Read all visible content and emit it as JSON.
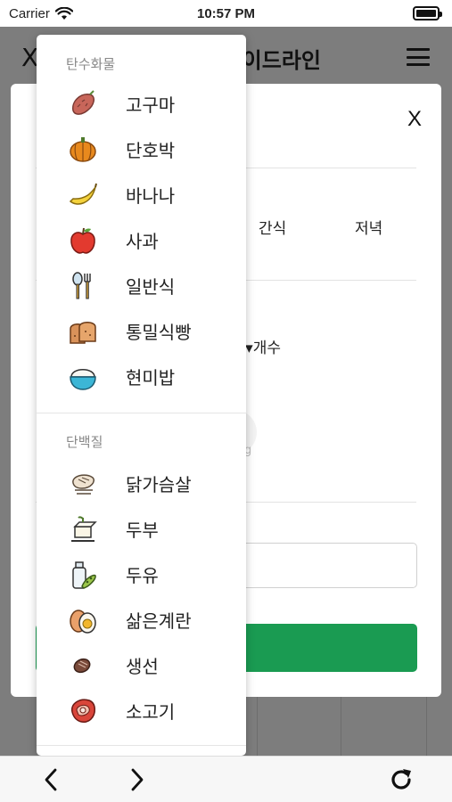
{
  "status_bar": {
    "carrier": "Carrier",
    "time": "10:57 PM"
  },
  "header": {
    "close_label": "X",
    "title": "식단 가이드라인"
  },
  "modal": {
    "close_label": "X",
    "meal_tabs": [
      "간식",
      "저녁"
    ],
    "unit_select_label": "개수▾",
    "ghost_text": "g"
  },
  "dropdown": {
    "groups": [
      {
        "title": "탄수화물",
        "items": [
          {
            "label": "고구마",
            "icon": "sweet-potato-icon"
          },
          {
            "label": "단호박",
            "icon": "pumpkin-icon"
          },
          {
            "label": "바나나",
            "icon": "banana-icon"
          },
          {
            "label": "사과",
            "icon": "apple-icon"
          },
          {
            "label": "일반식",
            "icon": "utensils-icon"
          },
          {
            "label": "통밀식빵",
            "icon": "bread-icon"
          },
          {
            "label": "현미밥",
            "icon": "rice-bowl-icon"
          }
        ]
      },
      {
        "title": "단백질",
        "items": [
          {
            "label": "닭가슴살",
            "icon": "chicken-breast-icon"
          },
          {
            "label": "두부",
            "icon": "tofu-icon"
          },
          {
            "label": "두유",
            "icon": "soy-milk-icon"
          },
          {
            "label": "삶은계란",
            "icon": "boiled-egg-icon"
          },
          {
            "label": "생선",
            "icon": "fish-icon"
          },
          {
            "label": "소고기",
            "icon": "beef-icon"
          }
        ]
      }
    ]
  },
  "bottom_bar": {
    "back_icon": "chevron-left-icon",
    "forward_icon": "chevron-right-icon",
    "reload_icon": "reload-icon"
  },
  "colors": {
    "accent_green": "#1a9b52",
    "overlay_gray": "#7d7d7d"
  }
}
